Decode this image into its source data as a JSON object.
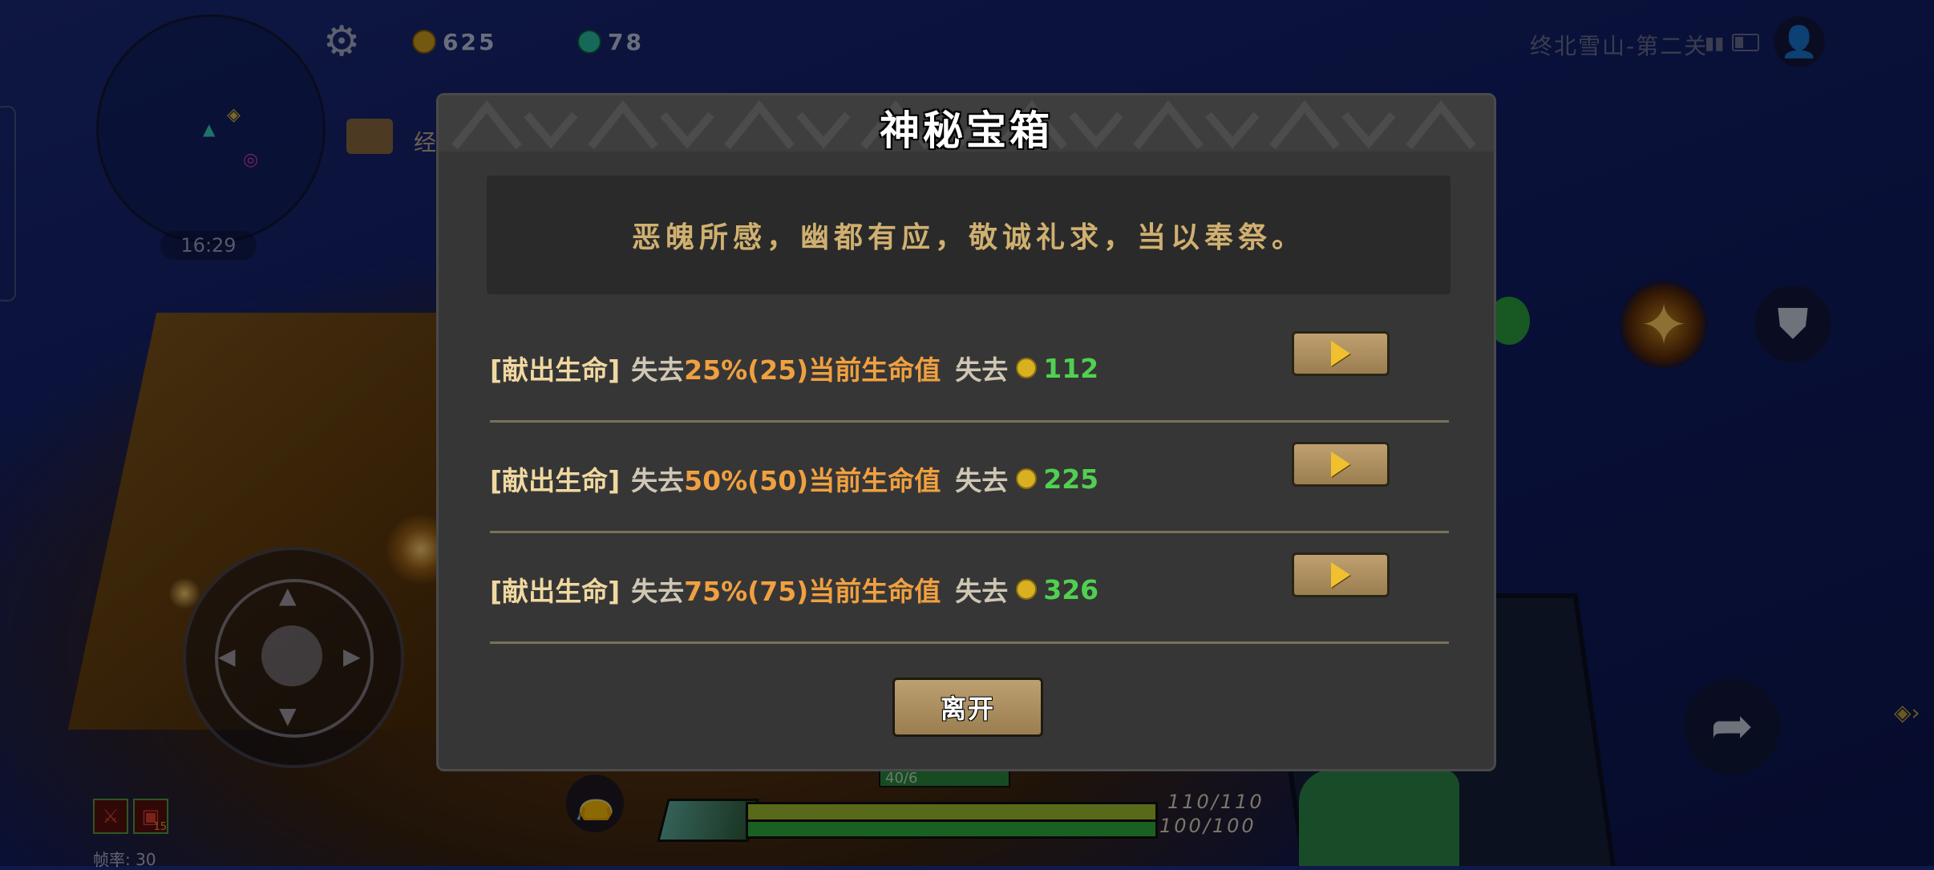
{
  "hud": {
    "time": "16:29",
    "gold": "625",
    "gems": "78",
    "bag_label": "经",
    "level_name": "终北雪山-第二关",
    "fps": "帧率: 30",
    "item_count": "15",
    "hp_text": "110/110",
    "mp_text": "100/100",
    "unit_hp": "40/6",
    "hp_fill": 1.0,
    "mp_fill": 1.0
  },
  "icons": {
    "settings": "gear-icon",
    "gold": "coin-icon",
    "gem": "gem-icon",
    "profile": "profile-icon",
    "skill_1": "claw-skill-icon",
    "skill_2": "shield-skill-icon",
    "skill_3": "dash-skill-icon",
    "bag": "bag-icon"
  },
  "dialog": {
    "title": "神秘宝箱",
    "description": "恶魄所感，幽都有应，敬诚礼求，当以奉祭。",
    "options": [
      {
        "tag": "[献出生命]",
        "lose_prefix": "失去",
        "hp_loss": "25%(25)当前生命值",
        "cost_prefix": "失去",
        "cost": "112"
      },
      {
        "tag": "[献出生命]",
        "lose_prefix": "失去",
        "hp_loss": "50%(50)当前生命值",
        "cost_prefix": "失去",
        "cost": "225"
      },
      {
        "tag": "[献出生命]",
        "lose_prefix": "失去",
        "hp_loss": "75%(75)当前生命值",
        "cost_prefix": "失去",
        "cost": "326"
      }
    ],
    "leave_label": "离开"
  },
  "colors": {
    "dialog_bg": "#363636",
    "description_text": "#d0b070",
    "percent_text": "#f0a040",
    "cost_text": "#50d050",
    "button": "#b09468"
  }
}
